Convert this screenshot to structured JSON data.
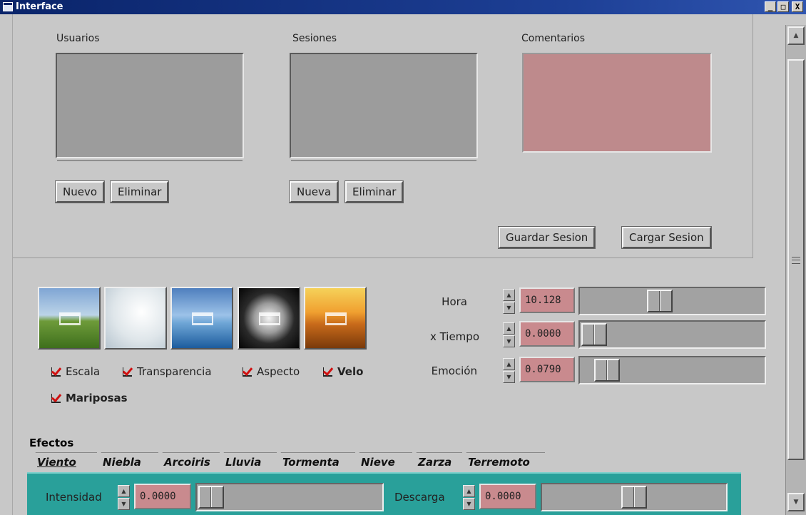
{
  "window": {
    "title": "Interface",
    "controls": {
      "minimize": "_",
      "maximize": "□",
      "close": "X"
    }
  },
  "session_panel": {
    "users_label": "Usuarios",
    "sessions_label": "Sesiones",
    "comments_label": "Comentarios",
    "users_new": "Nuevo",
    "users_delete": "Eliminar",
    "sessions_new": "Nueva",
    "sessions_delete": "Eliminar",
    "save_session": "Guardar Sesion",
    "load_session": "Cargar Sesion"
  },
  "scenes": [
    {
      "name": "scene-meadow-icon"
    },
    {
      "name": "scene-snow-icon"
    },
    {
      "name": "scene-water-icon"
    },
    {
      "name": "scene-night-icon"
    },
    {
      "name": "scene-desert-icon"
    }
  ],
  "options": {
    "escala": "Escala",
    "transparencia": "Transparencia",
    "aspecto": "Aspecto",
    "velo": "Velo",
    "mariposas": "Mariposas"
  },
  "parameters": {
    "hora": {
      "label": "Hora",
      "value": "10.128",
      "level": 0.42
    },
    "tiempo": {
      "label": "x Tiempo",
      "value": "0.0000",
      "level": 0.0
    },
    "emocion": {
      "label": "Emoción",
      "value": "0.0790",
      "level": 0.08
    }
  },
  "effects": {
    "label": "Efectos",
    "tabs": [
      "Viento",
      "Niebla",
      "Arcoiris",
      "Lluvia",
      "Tormenta",
      "Nieve",
      "Zarza",
      "Terremoto"
    ],
    "active_tab": "Viento",
    "intensidad": {
      "label": "Intensidad",
      "value": "0.0000",
      "level": 0.0
    },
    "descarga": {
      "label": "Descarga",
      "value": "0.0000",
      "level": 0.5
    }
  },
  "colors": {
    "titlebar": "#0a246a",
    "comment_bg": "#be8a8c",
    "field_bg": "#c98a8e",
    "effects_bg": "#29a09a",
    "check_mark": "#d01010"
  }
}
